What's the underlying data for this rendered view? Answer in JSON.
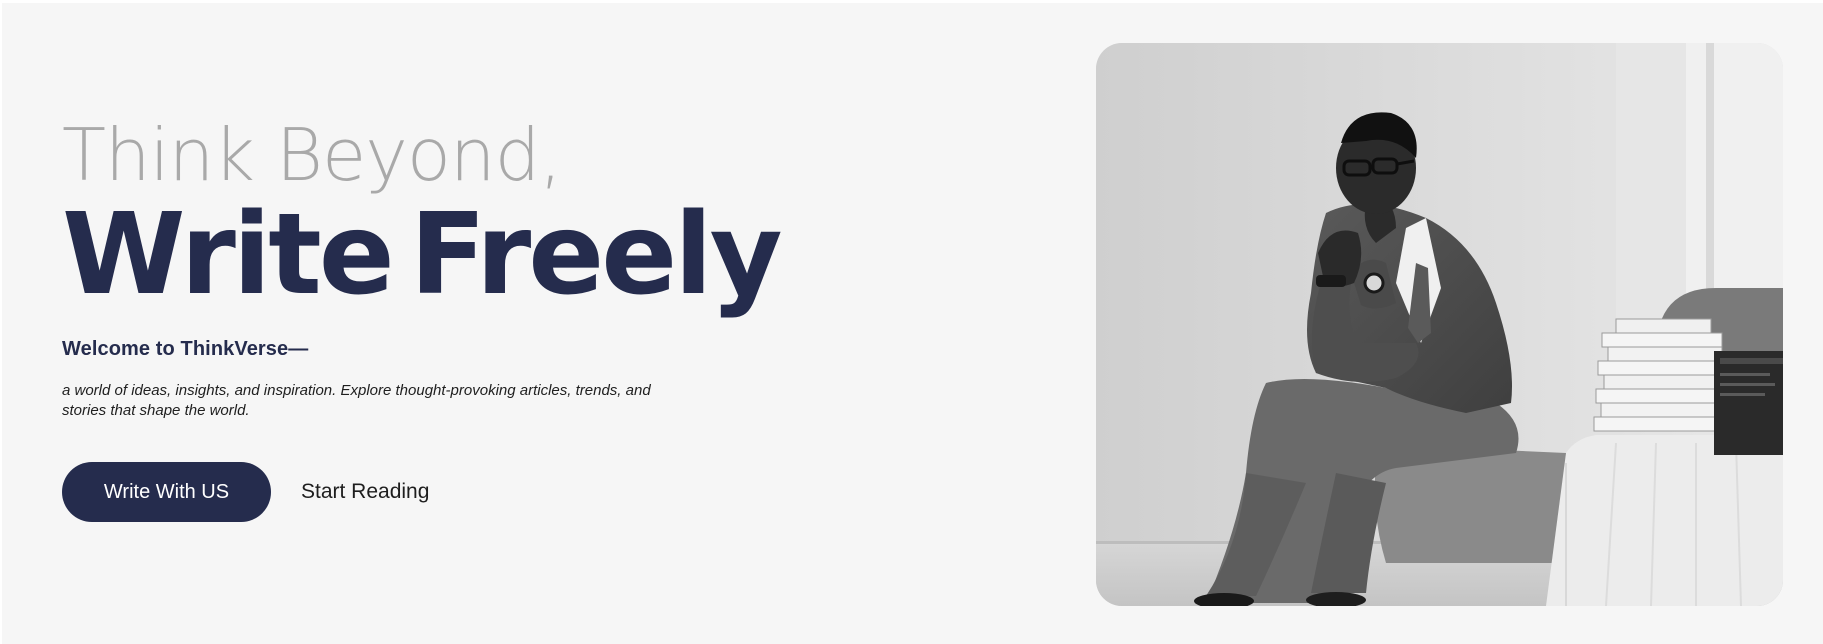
{
  "hero": {
    "headline_light": "Think Beyond,",
    "headline_bold_1": "Write",
    "headline_bold_2": "Freely",
    "welcome": "Welcome to ThinkVerse—",
    "description": "a world of ideas, insights, and inspiration. Explore thought-provoking articles, trends, and stories that shape the world.",
    "primary_button": "Write With US",
    "secondary_link": "Start Reading"
  },
  "colors": {
    "background": "#f6f6f6",
    "accent_navy": "#252c4d",
    "headline_gray": "#a9a9a9"
  },
  "image": {
    "subject": "black-and-white photo of a man in a suit sitting pensively beside a stack of books"
  }
}
